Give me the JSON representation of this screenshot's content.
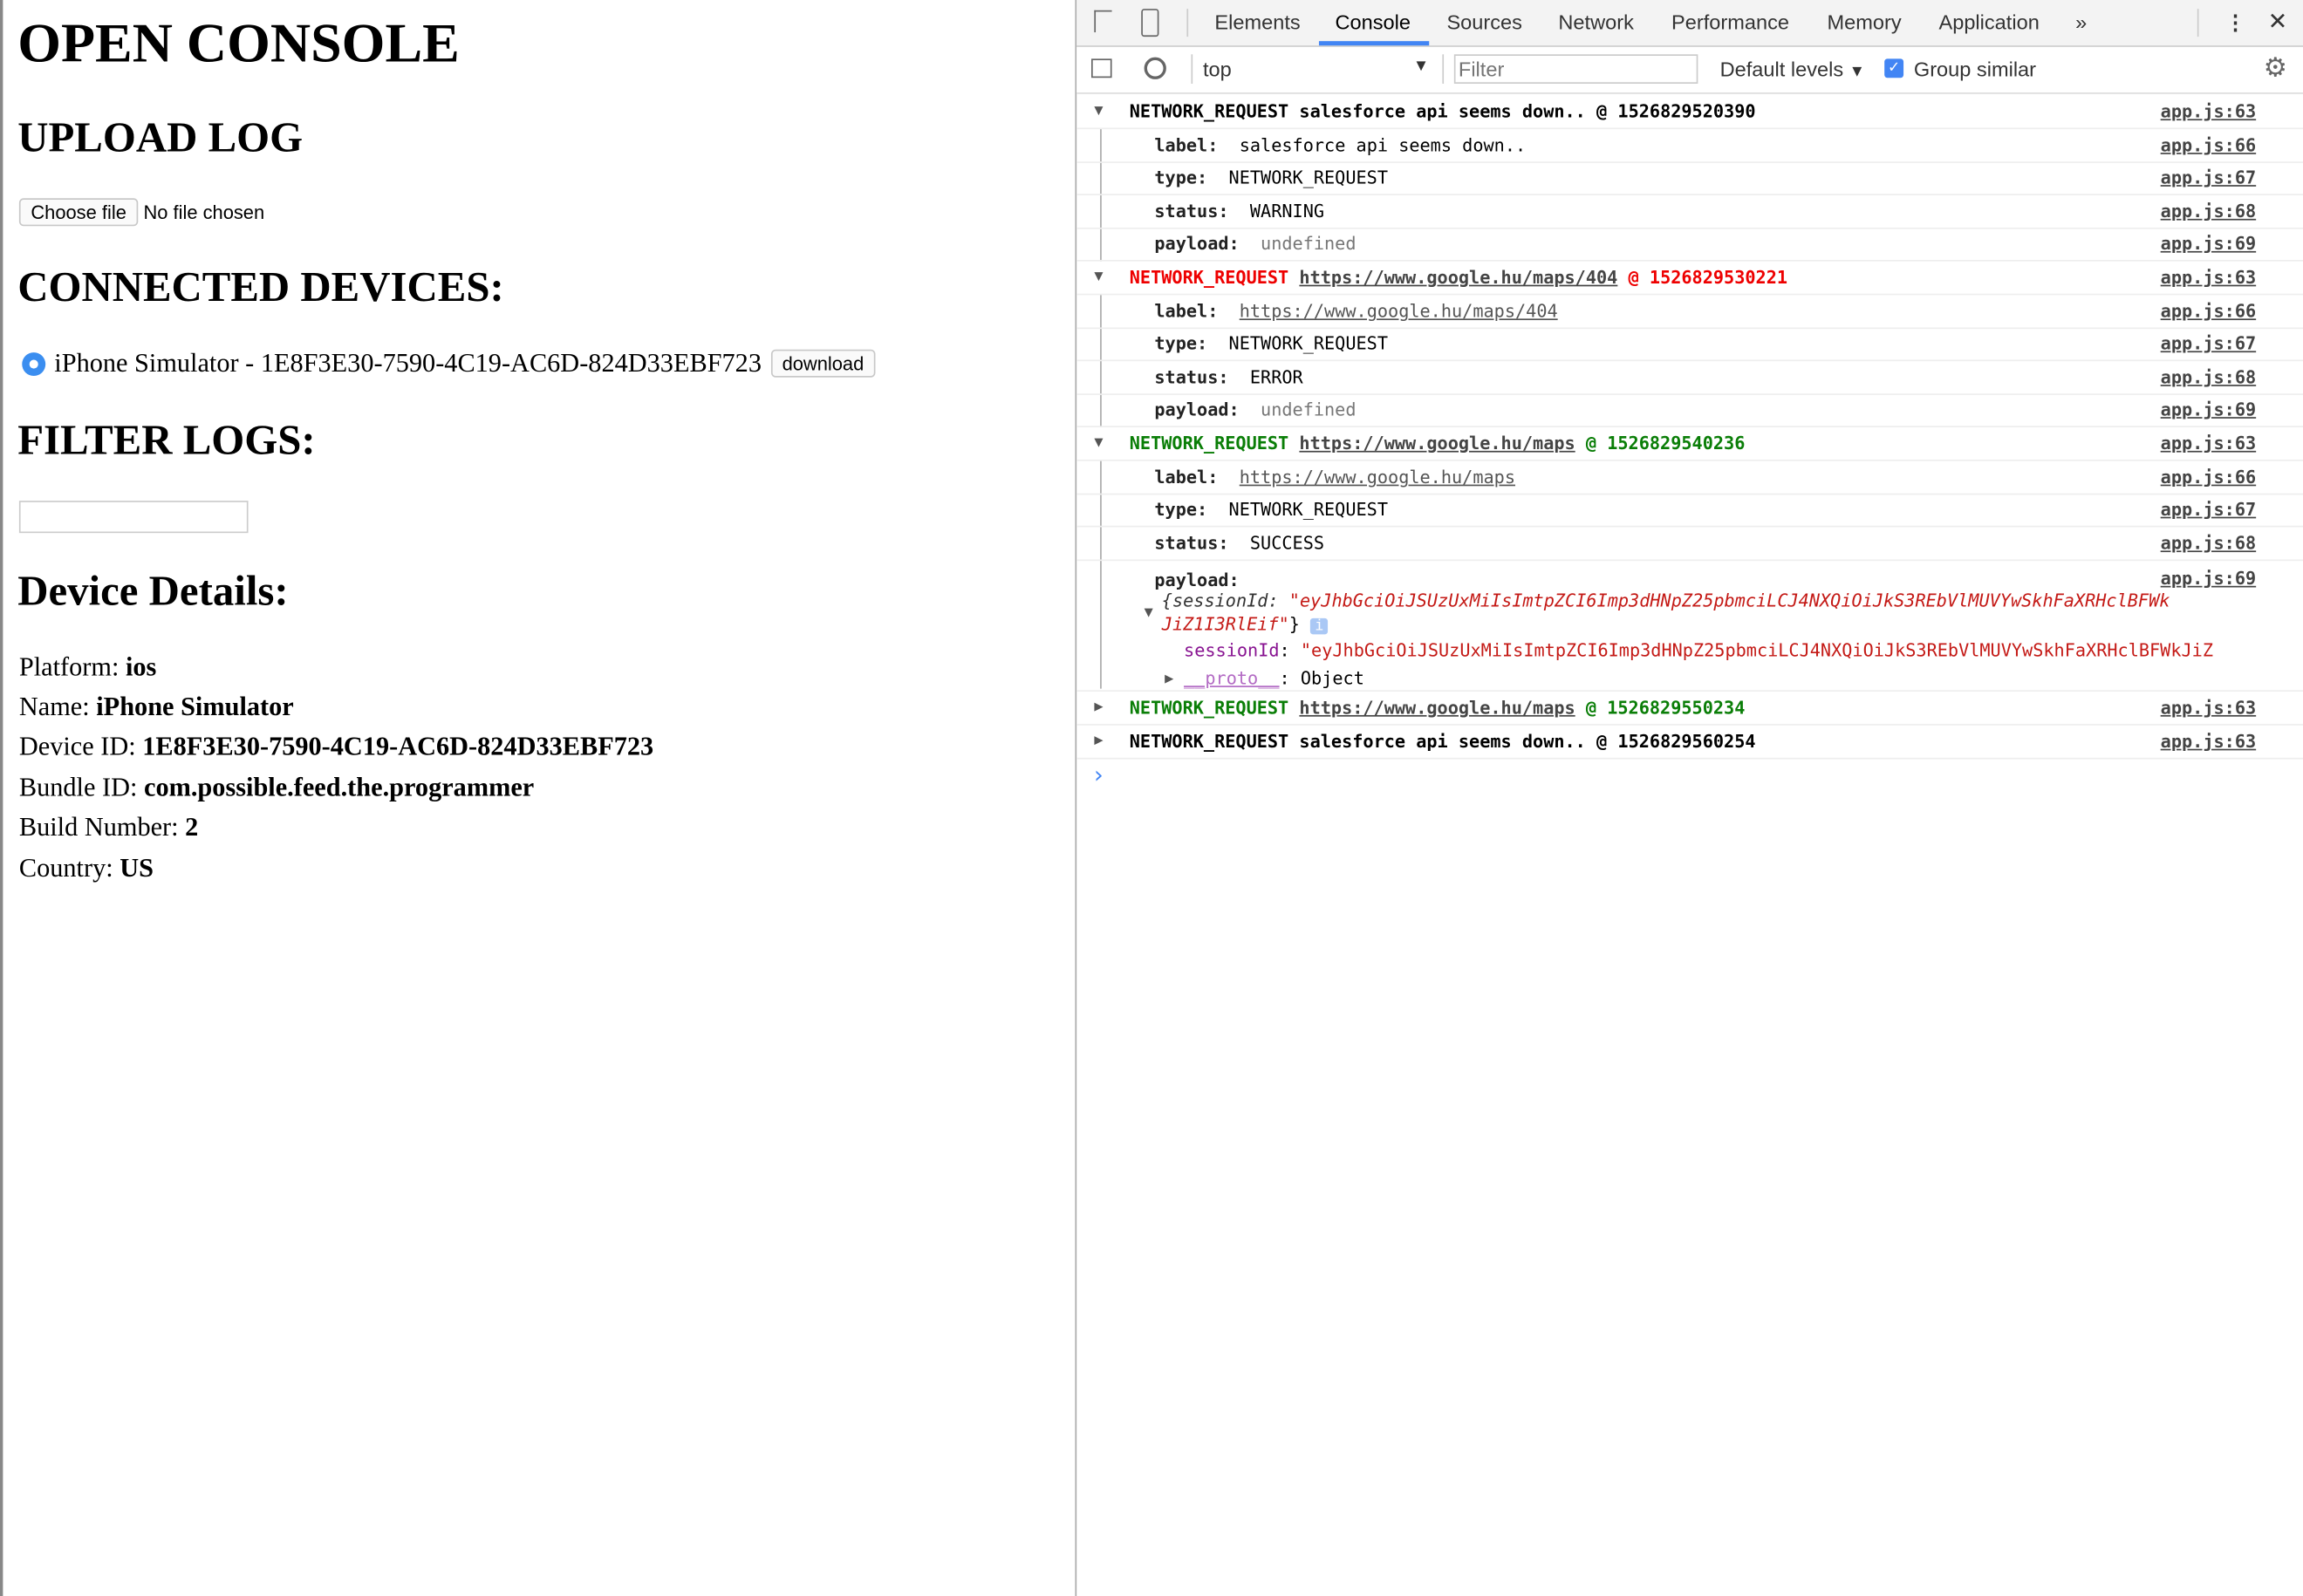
{
  "page": {
    "title": "OPEN CONSOLE",
    "upload_heading": "UPLOAD LOG",
    "choose_file": "Choose file",
    "no_file": "No file chosen",
    "devices_heading": "CONNECTED DEVICES:",
    "device_label": "iPhone Simulator - 1E8F3E30-7590-4C19-AC6D-824D33EBF723",
    "download": "download",
    "filter_heading": "FILTER LOGS:",
    "filter_value": "",
    "details_heading": "Device Details:",
    "details": [
      {
        "label": "Platform: ",
        "value": "ios"
      },
      {
        "label": "Name: ",
        "value": "iPhone Simulator"
      },
      {
        "label": "Device ID: ",
        "value": "1E8F3E30-7590-4C19-AC6D-824D33EBF723"
      },
      {
        "label": "Bundle ID: ",
        "value": "com.possible.feed.the.programmer"
      },
      {
        "label": "Build Number: ",
        "value": "2"
      },
      {
        "label": "Country: ",
        "value": "US"
      }
    ]
  },
  "devtools": {
    "tabs": [
      "Elements",
      "Console",
      "Sources",
      "Network",
      "Performance",
      "Memory",
      "Application"
    ],
    "active_tab": "Console",
    "more": "»",
    "context": "top",
    "filter_placeholder": "Filter",
    "levels": "Default levels",
    "group_similar": "Group similar",
    "group_similar_checked": true,
    "accent": "#4285f4"
  },
  "console": {
    "groups": [
      {
        "type": "NETWORK_REQUEST",
        "label": "salesforce api seems down..",
        "at": "@",
        "ts": "1526829520390",
        "color": "black",
        "expanded": true,
        "src": "app.js:63",
        "fields": [
          {
            "k": "label:",
            "v": "salesforce api seems down..",
            "src": "app.js:66"
          },
          {
            "k": "type:",
            "v": "NETWORK_REQUEST",
            "src": "app.js:67"
          },
          {
            "k": "status:",
            "v": "WARNING",
            "src": "app.js:68"
          },
          {
            "k": "payload:",
            "v": "undefined",
            "src": "app.js:69"
          }
        ]
      },
      {
        "type": "NETWORK_REQUEST",
        "label": "https://www.google.hu/maps/404",
        "at": "@",
        "ts": "1526829530221",
        "color": "red",
        "expanded": true,
        "src": "app.js:63",
        "fields": [
          {
            "k": "label:",
            "v": "https://www.google.hu/maps/404",
            "src": "app.js:66"
          },
          {
            "k": "type:",
            "v": "NETWORK_REQUEST",
            "src": "app.js:67"
          },
          {
            "k": "status:",
            "v": "ERROR",
            "src": "app.js:68"
          },
          {
            "k": "payload:",
            "v": "undefined",
            "src": "app.js:69"
          }
        ]
      },
      {
        "type": "NETWORK_REQUEST",
        "label": "https://www.google.hu/maps",
        "at": "@",
        "ts": "1526829540236",
        "color": "green",
        "expanded": true,
        "src": "app.js:63",
        "fields": [
          {
            "k": "label:",
            "v": "https://www.google.hu/maps",
            "src": "app.js:66"
          },
          {
            "k": "type:",
            "v": "NETWORK_REQUEST",
            "src": "app.js:67"
          },
          {
            "k": "status:",
            "v": "SUCCESS",
            "src": "app.js:68"
          },
          {
            "k": "payload:",
            "v": "",
            "src": "app.js:69"
          }
        ]
      },
      {
        "type": "NETWORK_REQUEST",
        "label": "https://www.google.hu/maps",
        "at": "@",
        "ts": "1526829550234",
        "color": "green",
        "expanded": false,
        "src": "app.js:63"
      },
      {
        "type": "NETWORK_REQUEST",
        "label": "salesforce api seems down..",
        "at": "@",
        "ts": "1526829560254",
        "color": "black",
        "expanded": false,
        "src": "app.js:63"
      }
    ],
    "payload": {
      "preview_key": "{sessionId: ",
      "preview_line1": "\"eyJhbGciOiJSUzUxMiIsImtpZCI6Imp3dHNpZ25pbmciLCJ4NXQiOiJkS3REbVlMUVYwSkhFaXRHclBFWk",
      "preview_line2": "JiZ1I3RlEif\"",
      "preview_close": "}",
      "info": "i",
      "key": "sessionId",
      "value": "\"eyJhbGciOiJSUzUxMiIsImtpZCI6Imp3dHNpZ25pbmciLCJ4NXQiOiJkS3REbVlMUVYwSkhFaXRHclBFWkJiZ",
      "proto_key": "__proto__",
      "proto_value": "Object"
    },
    "prompt": "›"
  }
}
